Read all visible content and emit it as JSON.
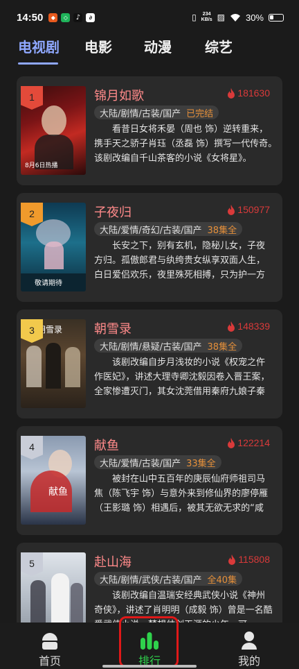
{
  "status": {
    "time": "14:50",
    "speed_top": "234",
    "speed_unit": "KB/s",
    "battery": "30%"
  },
  "tabs": [
    {
      "label": "电视剧"
    },
    {
      "label": "电影"
    },
    {
      "label": "动漫"
    },
    {
      "label": "综艺"
    }
  ],
  "cards": [
    {
      "rank": "1",
      "title": "锦月如歌",
      "heat": "181630",
      "tags": "大陆/剧情/古装/国产",
      "episodes": "已完结",
      "desc": "看昔日女将禾晏（周也 饰）逆转重来，携手天之骄子肖珏（丞磊 饰）撰写一代传奇。　　该剧改编自千山茶客的小说《女将星》。",
      "poster_caption": "8月6日热播"
    },
    {
      "rank": "2",
      "title": "子夜归",
      "heat": "150977",
      "tags": "大陆/爱情/奇幻/古装/国产",
      "episodes": "38集全",
      "desc": "长安之下，别有玄机，隐秘儿女，子夜方归。孤傲郎君与纨绔贵女纵享双面人生，白日爱侣欢乐，夜里殊死相搏，只为护一方太平，佑海晏河清。",
      "poster_caption": "敬请期待"
    },
    {
      "rank": "3",
      "title": "朝雪录",
      "heat": "148339",
      "tags": "大陆/剧情/悬疑/古装/国产",
      "episodes": "38集全",
      "desc": "该剧改编自步月浅妆的小说《权宠之仵作医妃》，讲述大理寺卿沈毅因卷入晋王案，全家惨遭灭门，其女沈莞借用秦府九娘子秦莞的身份入京查案的故事。",
      "poster_caption": "朝雪录"
    },
    {
      "rank": "4",
      "title": "献鱼",
      "heat": "122214",
      "tags": "大陆/爱情/古装/国产",
      "episodes": "33集全",
      "desc": "被封在山中五百年的庚辰仙府师祖司马焦（陈飞宇 饰）与意外来到修仙界的廖停雁（王影璐 饰）相遇后，被其无欲无求的“咸鱼”本能降服，由此展开一段奇妙故事。",
      "poster_caption": "献鱼"
    },
    {
      "rank": "5",
      "title": "赴山海",
      "heat": "115808",
      "tags": "大陆/剧情/武侠/古装/国产",
      "episodes": "全40集",
      "desc": "该剧改编自温瑞安经典武侠小说《神州奇侠》，讲述了肖明明（成毅 饰）曾是一名酷爱武侠小说、梦想仗剑天涯的少年，可他……",
      "poster_caption": ""
    }
  ],
  "nav": [
    {
      "label": "首页",
      "icon": "home-icon"
    },
    {
      "label": "排行",
      "icon": "ranking-bars-icon"
    },
    {
      "label": "我的",
      "icon": "profile-icon"
    }
  ],
  "colors": {
    "accent_tab": "#8fa8ff",
    "title": "#ff8a8a",
    "heat": "#d93a3a",
    "episode": "#e6903a",
    "nav_active": "#2fd24c",
    "highlight": "#e01818"
  }
}
